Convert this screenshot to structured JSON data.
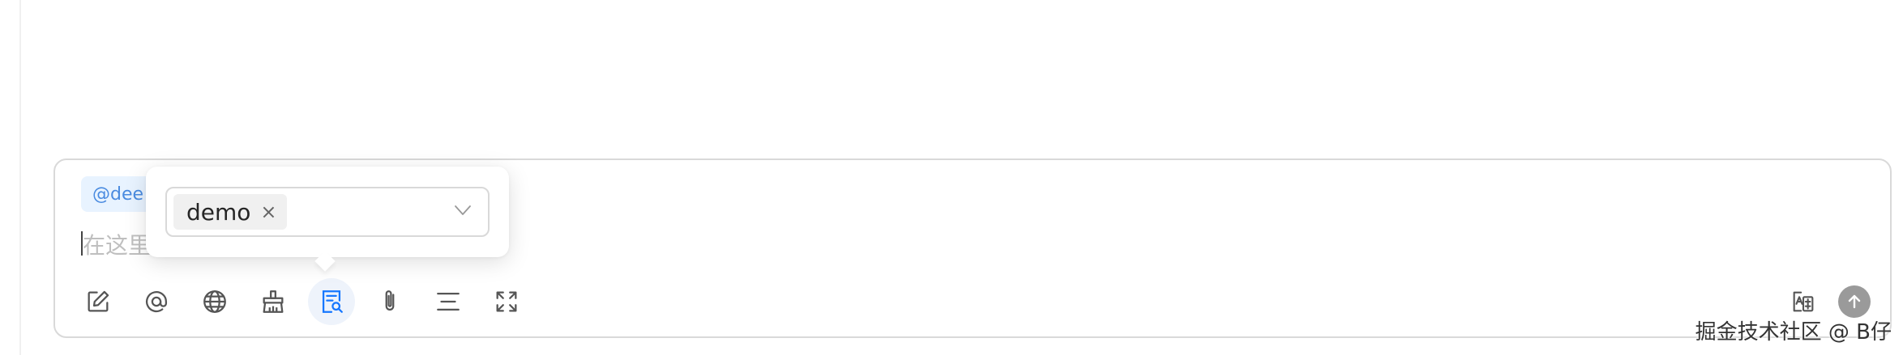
{
  "composer": {
    "mention_chip": "@dee",
    "input_placeholder": "在这里",
    "toolbar": {
      "icons": [
        "edit-icon",
        "at-icon",
        "globe-icon",
        "clean-icon",
        "document-search-icon",
        "attachment-icon",
        "divider-icon",
        "expand-icon"
      ],
      "active_icon": "document-search-icon"
    },
    "right_icons": [
      "translate-icon",
      "send-arrow-icon"
    ]
  },
  "popover": {
    "selected_tags": [
      "demo"
    ],
    "tag_remove_glyph": "×"
  },
  "watermark": "掘金技术社区 @ B仔",
  "colors": {
    "accent": "#1677ff",
    "chip_bg": "#e8f3ff",
    "chip_text": "#4a8be0",
    "border": "#d9d9d9",
    "send_button": "#9a9a9a"
  }
}
